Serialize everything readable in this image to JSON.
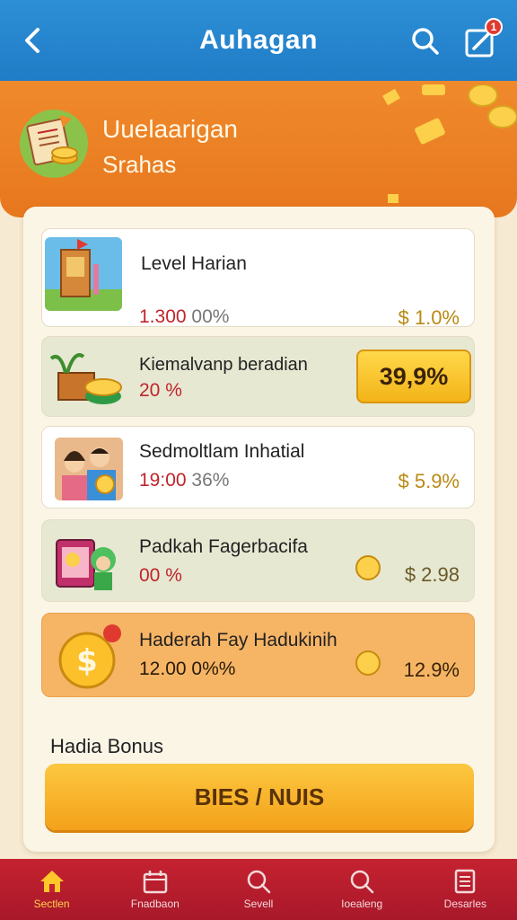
{
  "header": {
    "title": "Auhagan",
    "notification_count": "1"
  },
  "hero": {
    "line1": "Uuelaarigan",
    "line2": "Srahas"
  },
  "cards": [
    {
      "name": "Level Harian",
      "value_red": "1.300",
      "value_grey": "00%",
      "right": "$ 1.0%"
    },
    {
      "name": "Kiemalvanp beradian",
      "value_red": "20 %",
      "value_grey": "",
      "right": "39,9%"
    },
    {
      "name": "Sedmoltlam Inhatial",
      "value_red": "19:00",
      "value_grey": "36%",
      "right": "$ 5.9%"
    },
    {
      "name": "Padkah Fagerbacifa",
      "value_red": "00 %",
      "value_grey": "",
      "right": "$ 2.98"
    },
    {
      "name": "Haderah Fay Hadukinih",
      "value_red": "12.00",
      "value_grey": "0%%",
      "right": "12.9%"
    }
  ],
  "bonus": {
    "title": "Hadia Bonus",
    "button": "BIES / NUIS"
  },
  "nav": [
    {
      "label": "Sectlen",
      "icon": "home-icon"
    },
    {
      "label": "Fnadbaon",
      "icon": "calendar-icon"
    },
    {
      "label": "Sevell",
      "icon": "search-icon"
    },
    {
      "label": "Ioealeng",
      "icon": "search-icon"
    },
    {
      "label": "Desarles",
      "icon": "document-icon"
    }
  ],
  "colors": {
    "topbar": "#1f7cc6",
    "hero": "#e8771e",
    "bottomnav": "#b01c2c",
    "accent": "#f4a11a"
  }
}
